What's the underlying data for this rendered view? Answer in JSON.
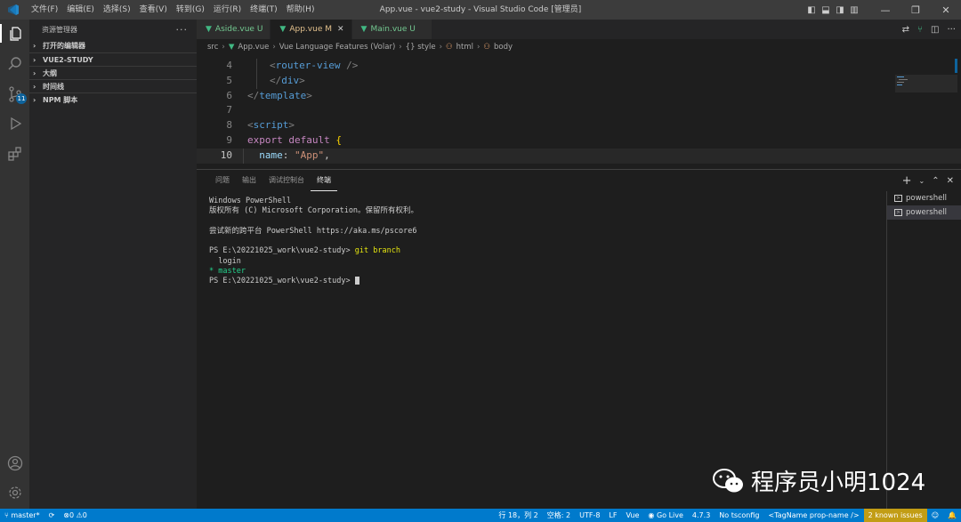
{
  "menu": [
    "文件(F)",
    "编辑(E)",
    "选择(S)",
    "查看(V)",
    "转到(G)",
    "运行(R)",
    "终端(T)",
    "帮助(H)"
  ],
  "window_title": "App.vue - vue2-study - Visual Studio Code [管理员]",
  "activity": {
    "scm_badge": "11"
  },
  "sidebar": {
    "title": "资源管理器",
    "sections": [
      "打开的编辑器",
      "VUE2-STUDY",
      "大纲",
      "时间线",
      "NPM 脚本"
    ]
  },
  "tabs": [
    {
      "name": "Aside.vue",
      "status": "U"
    },
    {
      "name": "App.vue",
      "status": "M"
    },
    {
      "name": "Main.vue",
      "status": "U"
    }
  ],
  "breadcrumbs": [
    "src",
    "App.vue",
    "Vue Language Features (Volar)",
    "{} style",
    "html",
    "body"
  ],
  "code": [
    {
      "n": "4",
      "text": "    <router-view />"
    },
    {
      "n": "5",
      "text": "  </div>"
    },
    {
      "n": "6",
      "text": "</template>"
    },
    {
      "n": "7",
      "text": ""
    },
    {
      "n": "8",
      "text": "<script>"
    },
    {
      "n": "9",
      "text": "export default {"
    },
    {
      "n": "10",
      "text": "  name: \"App\","
    }
  ],
  "panel": {
    "tabs": [
      "问题",
      "输出",
      "调试控制台",
      "终端"
    ],
    "terminals": [
      "powershell",
      "powershell"
    ]
  },
  "terminal": [
    "Windows PowerShell",
    "版权所有 (C) Microsoft Corporation。保留所有权利。",
    "",
    "尝试新的跨平台 PowerShell https://aka.ms/pscore6",
    "",
    "PS E:\\20221025_work\\vue2-study>",
    "  login",
    "* master",
    "PS E:\\20221025_work\\vue2-study>"
  ],
  "terminal_cmd": "git branch",
  "status": {
    "branch": "master*",
    "errors": "0",
    "warnings": "0",
    "position": "行 18，列 2",
    "spaces": "空格: 2",
    "encoding": "UTF-8",
    "eol": "LF",
    "language": "Vue",
    "golive": "Go Live",
    "version": "4.7.3",
    "tsconfig": "No tsconfig",
    "tagname": "<TagName prop-name />",
    "issues": "2 known issues"
  },
  "watermark": "程序员小明1024",
  "colors": {
    "accent": "#007acc",
    "vue": "#41b883",
    "warn": "#c29d15"
  }
}
